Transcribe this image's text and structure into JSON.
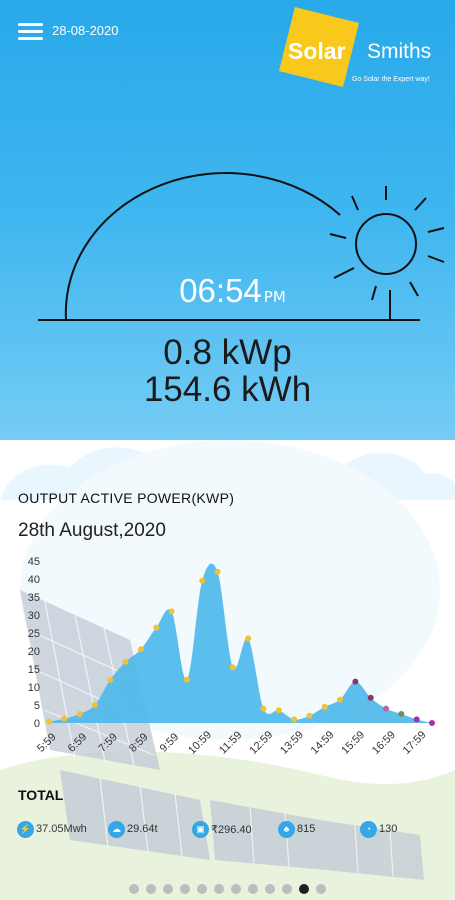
{
  "header": {
    "date": "28-08-2020",
    "logo_solar": "Solar",
    "logo_smiths": "Smiths",
    "logo_tagline": "Go Solar the Expert way!"
  },
  "hero": {
    "time": "06:54",
    "ampm": "PM",
    "power": "0.8 kWp",
    "energy": "154.6 kWh"
  },
  "chart_section": {
    "title": "OUTPUT ACTIVE POWER(KWP)",
    "date": "28th August,2020"
  },
  "chart_data": {
    "type": "area",
    "title": "OUTPUT ACTIVE POWER(KWP)",
    "subtitle": "28th August,2020",
    "xlabel": "",
    "ylabel": "",
    "ylim": [
      0,
      45
    ],
    "yticks": [
      0,
      5,
      10,
      15,
      20,
      25,
      30,
      35,
      40,
      45
    ],
    "xtick_labels": [
      "5:59",
      "6:59",
      "7:59",
      "8:59",
      "9:59",
      "10:59",
      "11:59",
      "12:59",
      "13:59",
      "14:59",
      "15:59",
      "16:59",
      "17:59"
    ],
    "fill_color": "#4fb9ea",
    "grid": false,
    "series": [
      {
        "x": [
          5.98,
          6.48,
          6.98,
          7.48,
          7.98,
          8.48,
          8.98,
          9.48,
          9.98,
          10.48,
          10.98,
          11.48,
          11.98,
          12.48,
          12.98,
          13.48,
          13.98,
          14.48,
          14.98,
          15.48,
          15.98,
          16.48,
          16.98,
          17.48,
          17.98,
          18.48
        ],
        "values": [
          0.3,
          1.2,
          2.5,
          5,
          12,
          17,
          20.5,
          26.5,
          31,
          12,
          39.5,
          42,
          15.5,
          23.5,
          4,
          3.5,
          1,
          2,
          4.5,
          6.5,
          11.5,
          7,
          4,
          2.5,
          1,
          0
        ],
        "point_colors": [
          "#f3c234",
          "#f3c234",
          "#f3c234",
          "#f3c234",
          "#f3c234",
          "#f3c234",
          "#f3c234",
          "#f3c234",
          "#f3c234",
          "#f3c234",
          "#f3c234",
          "#f3c234",
          "#f3c234",
          "#f3c234",
          "#f3c234",
          "#f3c234",
          "#f3c234",
          "#f3c234",
          "#f3c234",
          "#f3c234",
          "#8e3372",
          "#8e3372",
          "#b06aa9",
          "#6a8f6a",
          "#b02aa8",
          "#b02aa8"
        ]
      }
    ]
  },
  "totals": {
    "label": "TOTAL",
    "items": [
      {
        "icon": "energy-icon",
        "value": "37.05Mwh"
      },
      {
        "icon": "cloud-icon",
        "value": "29.64t"
      },
      {
        "icon": "wallet-icon",
        "value": "₹296.40"
      },
      {
        "icon": "tree-icon",
        "value": "815"
      },
      {
        "icon": "gauge-icon",
        "value": "130"
      }
    ]
  },
  "pager": {
    "count": 12,
    "active_index": 10
  },
  "colors": {
    "sky_top": "#28a9ea",
    "accent": "#35a6e6",
    "logo_yellow": "#f8c91a"
  }
}
